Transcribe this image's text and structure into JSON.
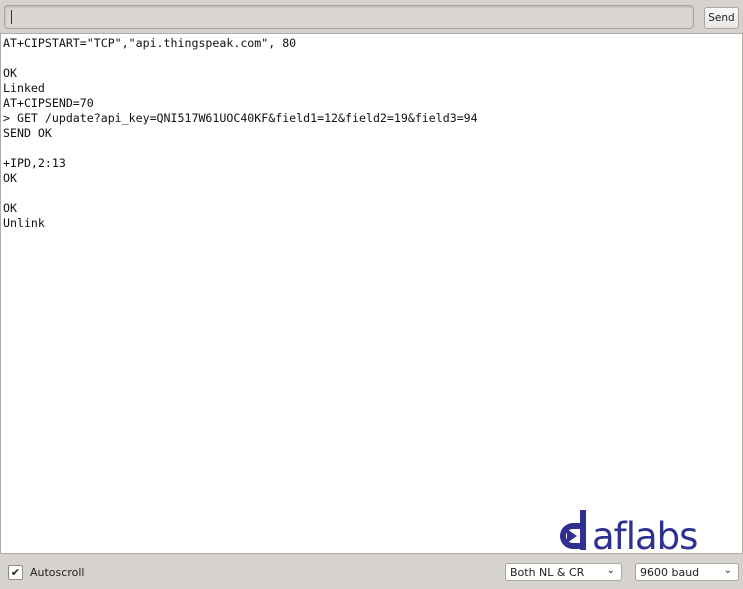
{
  "input": {
    "value": "",
    "send_label": "Send"
  },
  "output": {
    "lines": [
      "AT+CIPSTART=\"TCP\",\"api.thingspeak.com\", 80",
      "",
      "OK",
      "Linked",
      "AT+CIPSEND=70",
      "> GET /update?api_key=QNI517W61UOC40KF&field1=12&field2=19&field3=94",
      "SEND OK",
      "",
      "+IPD,2:13",
      "OK",
      "",
      "OK",
      "Unlink"
    ]
  },
  "logo": {
    "text": "daflabs",
    "color": "#2e3192"
  },
  "footer": {
    "autoscroll_label": "Autoscroll",
    "autoscroll_checked": true,
    "line_ending": "Both NL & CR",
    "baud_rate": "9600 baud"
  }
}
